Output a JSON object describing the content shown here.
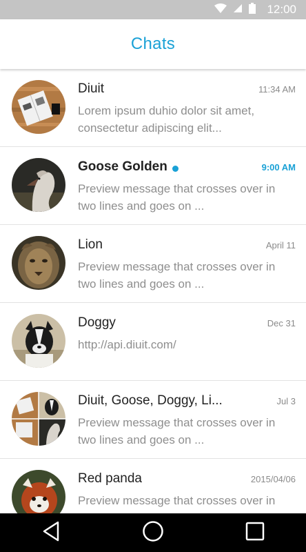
{
  "status_bar": {
    "time": "12:00",
    "icons": [
      "wifi-icon",
      "signal-icon",
      "battery-icon"
    ]
  },
  "app_bar": {
    "title": "Chats"
  },
  "colors": {
    "accent": "#1aa1d6",
    "status_bar": "#c4c4c4",
    "nav_bar": "#000000"
  },
  "chats": [
    {
      "name": "Diuit",
      "time": "11:34 AM",
      "preview": "Lorem ipsum duhio dolor sit amet, consectetur adipiscing elit...",
      "unread": false,
      "avatar": "notebook-avatar"
    },
    {
      "name": "Goose Golden",
      "time": "9:00 AM",
      "preview": "Preview message that crosses over in two lines and goes on ...",
      "unread": true,
      "avatar": "goose-avatar"
    },
    {
      "name": "Lion",
      "time": "April 11",
      "preview": "Preview message that crosses over in two lines and goes on ...",
      "unread": false,
      "avatar": "lion-avatar"
    },
    {
      "name": "Doggy",
      "time": "Dec 31",
      "preview": "http://api.diuit.com/",
      "unread": false,
      "avatar": "dog-avatar"
    },
    {
      "name": "Diuit, Goose, Doggy, Li...",
      "time": "Jul 3",
      "preview": "Preview message that crosses over in two lines and goes on ...",
      "unread": false,
      "avatar": "group-avatar"
    },
    {
      "name": "Red panda",
      "time": "2015/04/06",
      "preview": "Preview message that crosses over in two lines and goes on ...",
      "unread": false,
      "avatar": "red-panda-avatar"
    }
  ],
  "nav_bar": {
    "buttons": [
      "back-icon",
      "home-icon",
      "recents-icon"
    ]
  }
}
